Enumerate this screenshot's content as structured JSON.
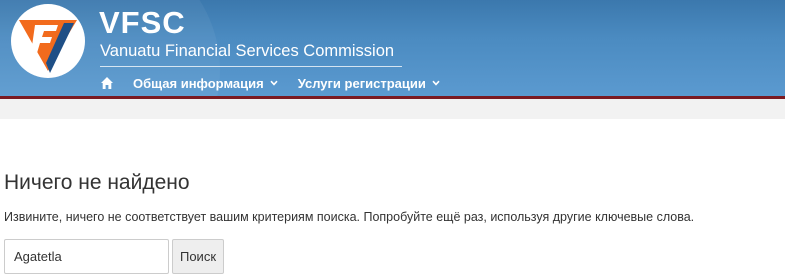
{
  "header": {
    "logo_icon": "vfsc-logo-icon",
    "site_name": "VFSC",
    "site_subtitle": "Vanuatu Financial Services Commission",
    "colors": {
      "header_blue": "#4b8bc1",
      "accent_maroon": "#7a1a22",
      "logo_orange": "#f26b1d"
    }
  },
  "nav": {
    "home_icon": "home-icon",
    "items": [
      {
        "label": "Общая информация",
        "icon": "chevron-down-icon"
      },
      {
        "label": "Услуги регистрации",
        "icon": "chevron-down-icon"
      }
    ]
  },
  "main": {
    "title": "Ничего не найдено",
    "message": "Извините, ничего не соответствует вашим критериям поиска. Попробуйте ещё раз, используя другие ключевые слова.",
    "search": {
      "value": "Agatetla",
      "button_label": "Поиск"
    }
  }
}
